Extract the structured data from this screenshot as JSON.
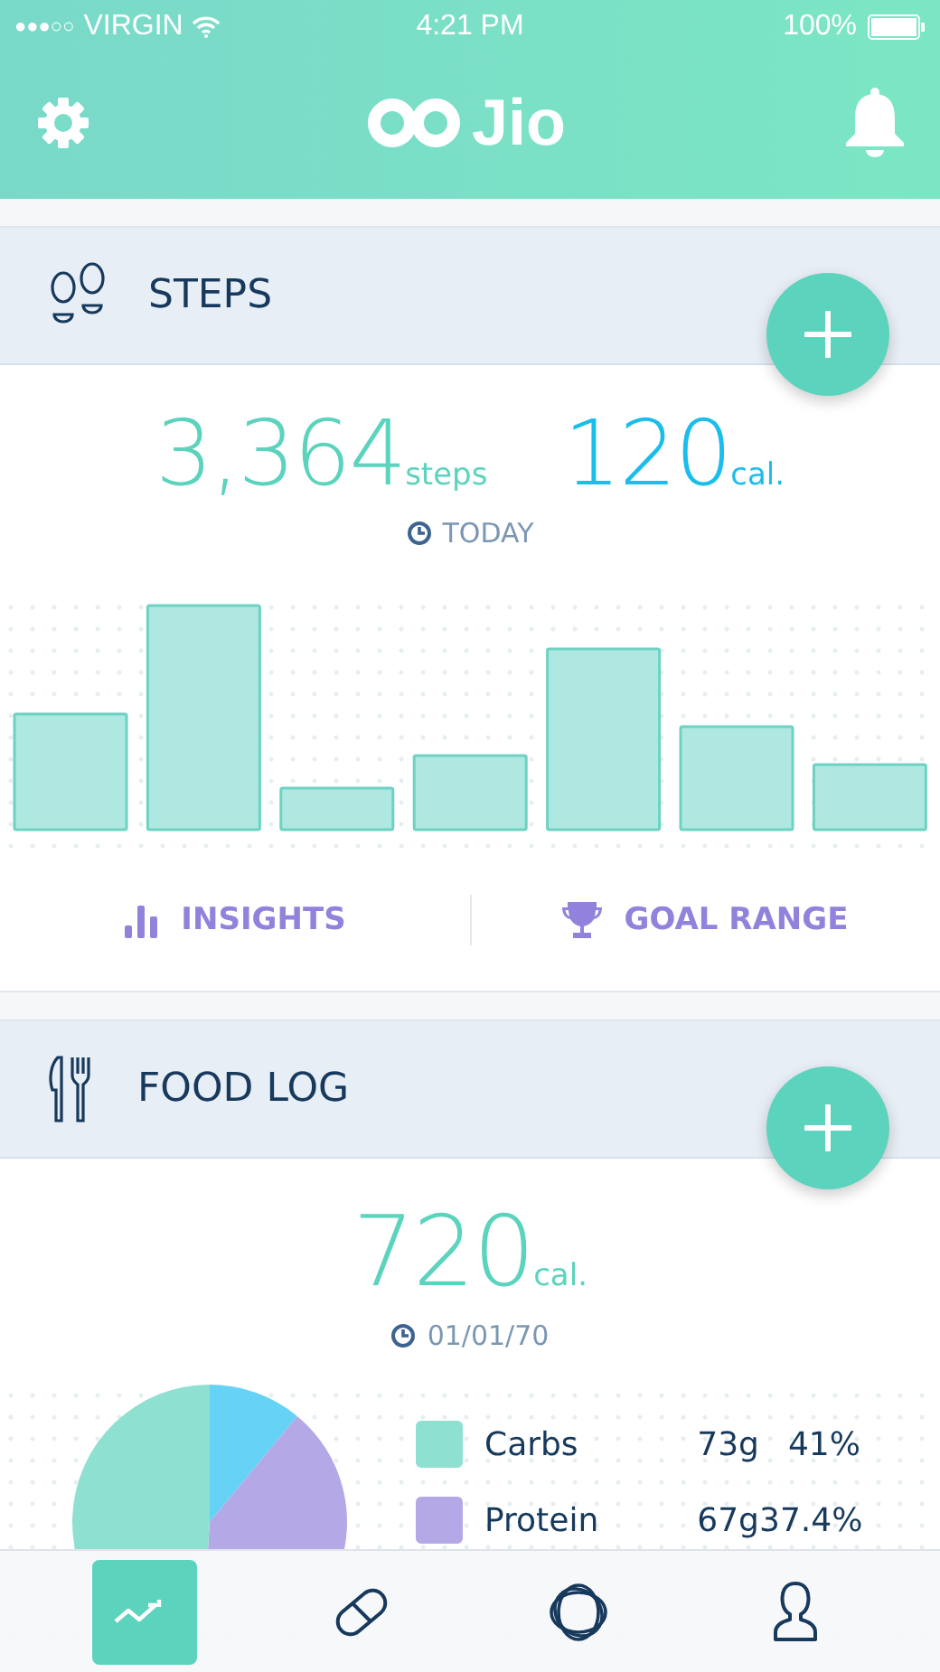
{
  "status_bar": {
    "signal": "●●●○○",
    "carrier": "VIRGIN",
    "time": "4:21 PM",
    "battery": "100%"
  },
  "header": {
    "logo": "Jio"
  },
  "steps": {
    "title": "STEPS",
    "steps_value": "3,364",
    "steps_unit": "steps",
    "cal_value": "120",
    "cal_unit": "cal.",
    "period": "TODAY",
    "actions": [
      {
        "kind": "insights",
        "label": "INSIGHTS"
      },
      {
        "kind": "goal",
        "label": "GOAL RANGE"
      }
    ]
  },
  "food_log": {
    "title": "FOOD LOG",
    "cal_value": "720",
    "cal_unit": "cal.",
    "date": "01/01/70",
    "macros": [
      {
        "name": "Carbs",
        "grams": "73g",
        "percent": "41%",
        "color": "#8ee0d0"
      },
      {
        "name": "Protein",
        "grams": "67g",
        "percent": "37.4%",
        "color": "#b5a8e6"
      }
    ]
  },
  "tab_bar": {
    "items": [
      {
        "kind": "trend",
        "selected": true
      },
      {
        "kind": "pill",
        "selected": false
      },
      {
        "kind": "orbit",
        "selected": false
      },
      {
        "kind": "person",
        "selected": false
      }
    ]
  }
}
